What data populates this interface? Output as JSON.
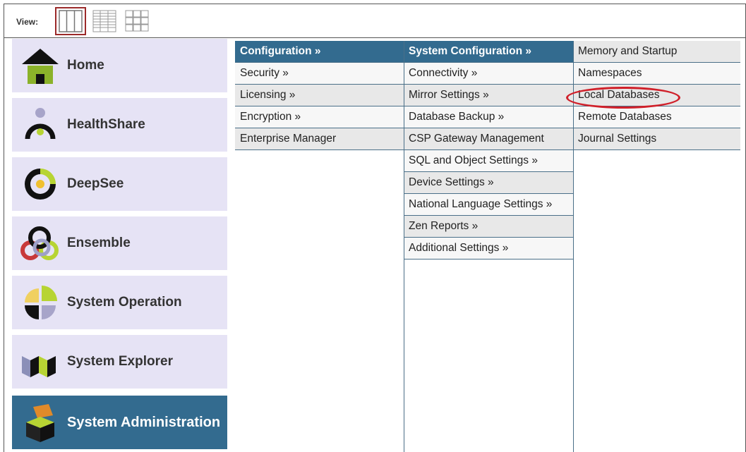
{
  "view": {
    "label": "View:",
    "buttons": [
      {
        "name": "columns-view",
        "selected": true
      },
      {
        "name": "list-view",
        "selected": false
      },
      {
        "name": "grid-view",
        "selected": false
      }
    ]
  },
  "nav": {
    "items": [
      {
        "label": "Home",
        "icon": "home-icon"
      },
      {
        "label": "HealthShare",
        "icon": "healthshare-icon"
      },
      {
        "label": "DeepSee",
        "icon": "deepsee-icon"
      },
      {
        "label": "Ensemble",
        "icon": "ensemble-icon"
      },
      {
        "label": "System Operation",
        "icon": "system-operation-icon"
      },
      {
        "label": "System Explorer",
        "icon": "system-explorer-icon"
      },
      {
        "label": "System Administration",
        "icon": "system-administration-icon",
        "active": true
      }
    ]
  },
  "menu": {
    "col1": [
      "Configuration »",
      "Security »",
      "Licensing »",
      "Encryption »",
      "Enterprise Manager"
    ],
    "col2": [
      "System Configuration »",
      "Connectivity »",
      "Mirror Settings »",
      "Database Backup »",
      "CSP Gateway Management",
      "SQL and Object Settings »",
      "Device Settings »",
      "National Language Settings »",
      "Zen Reports »",
      "Additional Settings »"
    ],
    "col3": [
      "Memory and Startup",
      "Namespaces",
      "Local Databases",
      "Remote Databases",
      "Journal Settings"
    ]
  },
  "colors": {
    "header_blue": "#336b8f",
    "nav_bg": "#e6e3f5",
    "highlight_red": "#d0202a"
  }
}
